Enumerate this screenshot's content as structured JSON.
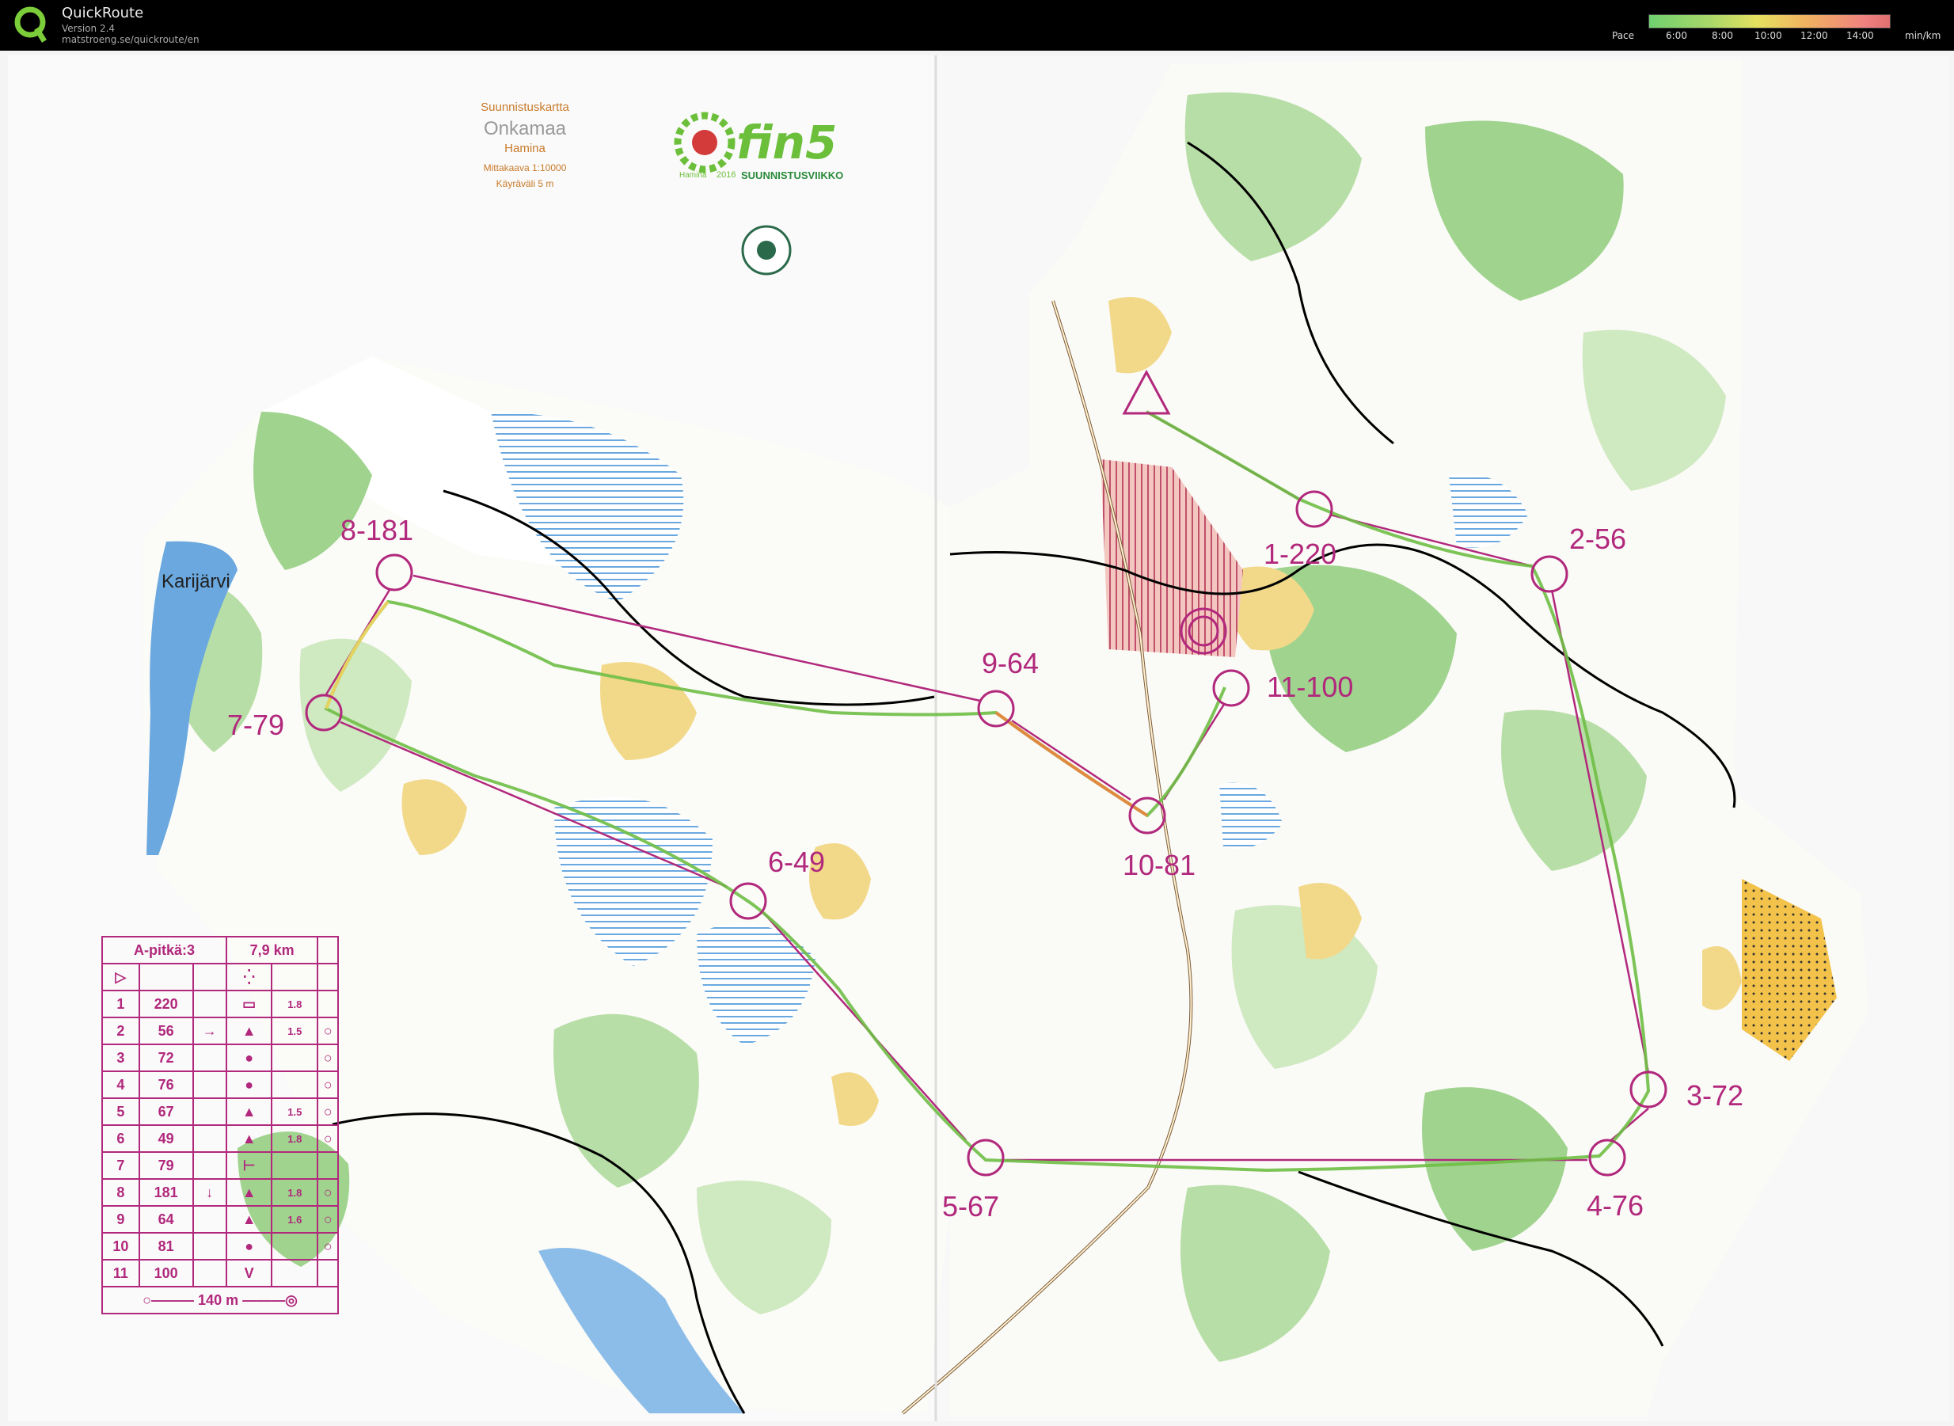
{
  "app": {
    "name": "QuickRoute",
    "version": "Version 2.4",
    "url": "matstroeng.se/quickroute/en"
  },
  "pace": {
    "label": "Pace",
    "ticks": [
      "6:00",
      "8:00",
      "10:00",
      "12:00",
      "14:00"
    ],
    "unit": "min/km"
  },
  "map": {
    "title_line1": "Suunnistuskartta",
    "title_line2": "Onkamaa",
    "title_line3": "Hamina",
    "scale": "Mittakaava 1:10000",
    "contour": "Käyräväli 5 m",
    "brand": "fin5",
    "brand_sub": "SUUNNISTUSVIIKKO",
    "brand_year": "2016",
    "brand_place": "Hamina",
    "lake_name": "Karijärvi"
  },
  "controls": [
    {
      "label": "1-220"
    },
    {
      "label": "2-56"
    },
    {
      "label": "3-72"
    },
    {
      "label": "4-76"
    },
    {
      "label": "5-67"
    },
    {
      "label": "6-49"
    },
    {
      "label": "7-79"
    },
    {
      "label": "8-181"
    },
    {
      "label": "9-64"
    },
    {
      "label": "10-81"
    },
    {
      "label": "11-100"
    }
  ],
  "legend": {
    "course": "A-pitkä:3",
    "length": "7,9 km",
    "rows": [
      {
        "n": "1",
        "code": "220",
        "extra": "1.8"
      },
      {
        "n": "2",
        "code": "56",
        "extra": "1.5"
      },
      {
        "n": "3",
        "code": "72",
        "extra": ""
      },
      {
        "n": "4",
        "code": "76",
        "extra": ""
      },
      {
        "n": "5",
        "code": "67",
        "extra": "1.5"
      },
      {
        "n": "6",
        "code": "49",
        "extra": "1.8"
      },
      {
        "n": "7",
        "code": "79",
        "extra": ""
      },
      {
        "n": "8",
        "code": "181",
        "extra": "1.8"
      },
      {
        "n": "9",
        "code": "64",
        "extra": "1.6"
      },
      {
        "n": "10",
        "code": "81",
        "extra": ""
      },
      {
        "n": "11",
        "code": "100",
        "extra": ""
      }
    ],
    "finish_distance": "140 m"
  },
  "colors": {
    "course": "#b1287c",
    "forest_green": "#9fd38e",
    "light_green": "#cfe9c1",
    "water": "#6aa8df",
    "open_yellow": "#f2d98a",
    "contour_brown": "#c98a4a"
  }
}
